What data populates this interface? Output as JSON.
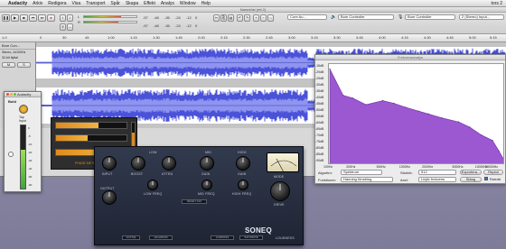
{
  "menubar": {
    "app": "Audacity",
    "items": [
      "Arkiv",
      "Redigera",
      "Visa",
      "Transport",
      "Spår",
      "Skapa",
      "Effekt",
      "Analys",
      "Window",
      "Help"
    ],
    "clock": "tors 2"
  },
  "audacity": {
    "title": "Namnlöst (ett 2)",
    "toolbar": {
      "meter_left_label": "L",
      "meter_right_label": "R",
      "meter_scale": [
        "-57",
        "-48",
        "-36",
        "-24",
        "-12",
        "0"
      ],
      "meter_scale2": [
        "-57",
        "-48",
        "-36",
        "-24",
        "-12",
        "0"
      ],
      "input_device": "Core Au...",
      "input_label": "Bom Controller",
      "output_label": "Bom Controller",
      "channels": "2 (Stereo) Input..."
    },
    "ruler_ticks": [
      "1,0",
      "0",
      "30",
      "45",
      "1:00",
      "1:15",
      "1:30",
      "1:45",
      "2:00",
      "2:15",
      "2:30",
      "2:45",
      "3:00",
      "3:15",
      "3:30",
      "3:45",
      "4:00",
      "4:15",
      "4:30",
      "4:45",
      "5:00",
      "5:15"
    ],
    "track": {
      "name": "Bom Con...",
      "controls": [
        "Stereo, 44100Hz",
        "32-bit flyttal"
      ],
      "scale": [
        "1,0",
        "0,5",
        "0,0",
        "-0,5",
        "-1,0"
      ]
    },
    "colors": {
      "waveform": "#4a52d8",
      "waveform_light": "#8e94f0",
      "background": "#c4c4c4"
    }
  },
  "level_meter": {
    "title": "Audacity",
    "label": "Bold",
    "sublabels": [
      "Tap",
      "Input"
    ],
    "scale": [
      "0",
      "-5",
      "-10",
      "-20",
      "-30",
      "-40",
      "-50",
      "-60"
    ]
  },
  "freq_window": {
    "title": "Frekvensanalys",
    "y_labels": [
      "-15dB",
      "-20dB",
      "-25dB",
      "-30dB",
      "-35dB",
      "-40dB",
      "-45dB",
      "-50dB",
      "-55dB",
      "-60dB",
      "-65dB",
      "-70dB",
      "-75dB",
      "-80dB",
      "-85dB",
      "-90dB"
    ],
    "x_labels": [
      "100Hz",
      "200Hz",
      "500Hz",
      "1000Hz",
      "2000Hz",
      "5000Hz",
      "10000Hz",
      "20000Hz"
    ],
    "algorithm_label": "Algoritm:",
    "algorithm_value": "Spektrum",
    "function_label": "Funktioner:",
    "function_value": "Hanning  fönstring",
    "size_label": "Storlek:",
    "size_value": "512",
    "axis_label": "Axel:",
    "axis_value": "Linjär frekvens",
    "export_label": "Exportera...",
    "replot_label": "Replot",
    "close_label": "Stäng",
    "grid_label": "Rutnät",
    "fill_color": "#9b58d1"
  },
  "chart_data": {
    "type": "area",
    "title": "",
    "xlabel": "",
    "ylabel": "",
    "x": [
      100,
      150,
      200,
      300,
      500,
      700,
      1000,
      1500,
      2000,
      3000,
      5000,
      7000,
      10000,
      14000,
      17000,
      20000
    ],
    "values": [
      -18,
      -38,
      -40,
      -45,
      -42,
      -44,
      -47,
      -50,
      -52,
      -55,
      -58,
      -62,
      -68,
      -72,
      -80,
      -87
    ],
    "ylim": [
      -90,
      -15
    ],
    "xscale": "log",
    "grid": false
  },
  "mini_plugin": {
    "label": "PHASE METER"
  },
  "soneq": {
    "brand": "SONEQ",
    "bands": [
      "LOW",
      "MID",
      "HIGH"
    ],
    "knob_labels": [
      "BOOST",
      "ATTEN",
      "FREQ",
      "GAIN",
      "GAIN"
    ],
    "freq_labels": [
      "LOW FREQ",
      "MID FREQ",
      "HIGH FREQ"
    ],
    "input_label": "INPUT",
    "output_label": "OUTPUT",
    "drive_label": "DRIVE",
    "mode_label": "MODE",
    "buttons": [
      "ACTIVE",
      "HIGHPASS",
      "LOWPASS",
      "SATURATE"
    ],
    "loudness_label": "LOUDNESS",
    "value_readout": "RESET 100"
  }
}
